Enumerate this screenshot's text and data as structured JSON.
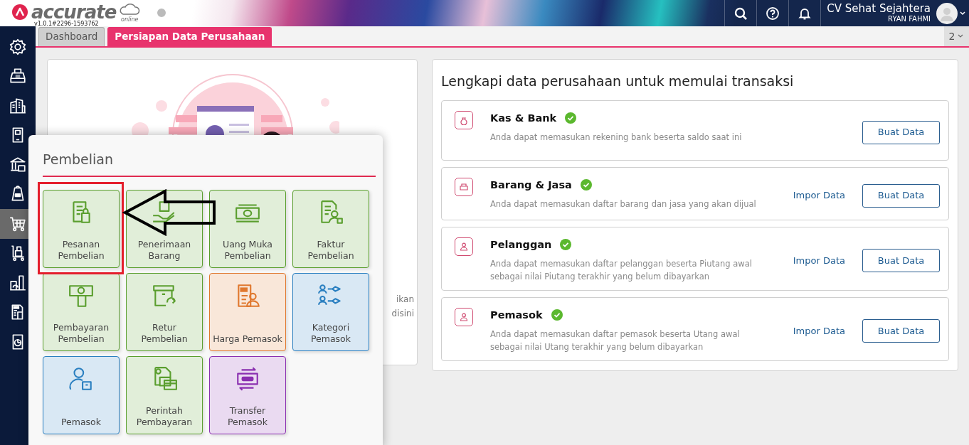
{
  "header": {
    "logo_text": "accurate",
    "logo_subtext": "online",
    "version": "v1.0.1#2296-1593762",
    "company": "CV Sehat Sejahtera",
    "user": "RYAN FAHMI"
  },
  "tabs": [
    {
      "label": "Dashboard",
      "selected": false
    },
    {
      "label": "Persiapan Data Perusahaan",
      "selected": true
    }
  ],
  "tab_counter": "2",
  "sidebar": {
    "items": [
      {
        "selected": false
      },
      {
        "selected": false
      },
      {
        "selected": false
      },
      {
        "selected": false
      },
      {
        "selected": false
      },
      {
        "selected": false
      },
      {
        "selected": true
      },
      {
        "selected": false
      },
      {
        "selected": false
      },
      {
        "selected": false
      },
      {
        "selected": false
      }
    ]
  },
  "intro_card": {
    "text_fragments": [
      "ikan",
      "disini"
    ]
  },
  "setup": {
    "title": "Lengkapi data perusahaan untuk memulai transaksi",
    "items": [
      {
        "title": "Kas & Bank",
        "done": true,
        "description": "Anda dapat memasukan rekening bank beserta saldo saat ini",
        "create_label": "Buat Data"
      },
      {
        "title": "Barang & Jasa",
        "done": true,
        "description": "Anda dapat memasukan daftar barang dan jasa yang akan dijual",
        "import_label": "Impor Data",
        "create_label": "Buat Data"
      },
      {
        "title": "Pelanggan",
        "done": true,
        "description": "Anda dapat memasukan daftar pelanggan beserta Piutang awal sebagai nilai Piutang terakhir yang belum dibayarkan",
        "import_label": "Impor Data",
        "create_label": "Buat Data"
      },
      {
        "title": "Pemasok",
        "done": true,
        "description": "Anda dapat memasukan daftar pemasok beserta Utang awal sebagai nilai Utang terakhir yang belum dibayarkan",
        "import_label": "Impor Data",
        "create_label": "Buat Data"
      }
    ]
  },
  "menu": {
    "title": "Pembelian",
    "tiles": [
      {
        "label": "Pesanan Pembelian",
        "color": "#5a9e2e",
        "highlighted": true
      },
      {
        "label": "Penerimaan Barang",
        "color": "#5a9e2e",
        "highlighted": false
      },
      {
        "label": "Uang Muka Pembelian",
        "color": "#5a9e2e",
        "highlighted": false
      },
      {
        "label": "Faktur Pembelian",
        "color": "#5a9e2e",
        "highlighted": false
      },
      {
        "label": "Pembayaran Pembelian",
        "color": "#5a9e2e",
        "highlighted": false
      },
      {
        "label": "Retur Pembelian",
        "color": "#5a9e2e",
        "highlighted": false
      },
      {
        "label": "Harga Pemasok",
        "color": "#e0782e",
        "highlighted": false
      },
      {
        "label": "Kategori Pemasok",
        "color": "#2a7fc0",
        "highlighted": false
      },
      {
        "label": "Pemasok",
        "color": "#2a7fc0",
        "highlighted": false
      },
      {
        "label": "Perintah Pembayaran",
        "color": "#5a9e2e",
        "highlighted": false
      },
      {
        "label": "Transfer Pemasok",
        "color": "#8a2fb0",
        "highlighted": false
      }
    ]
  }
}
